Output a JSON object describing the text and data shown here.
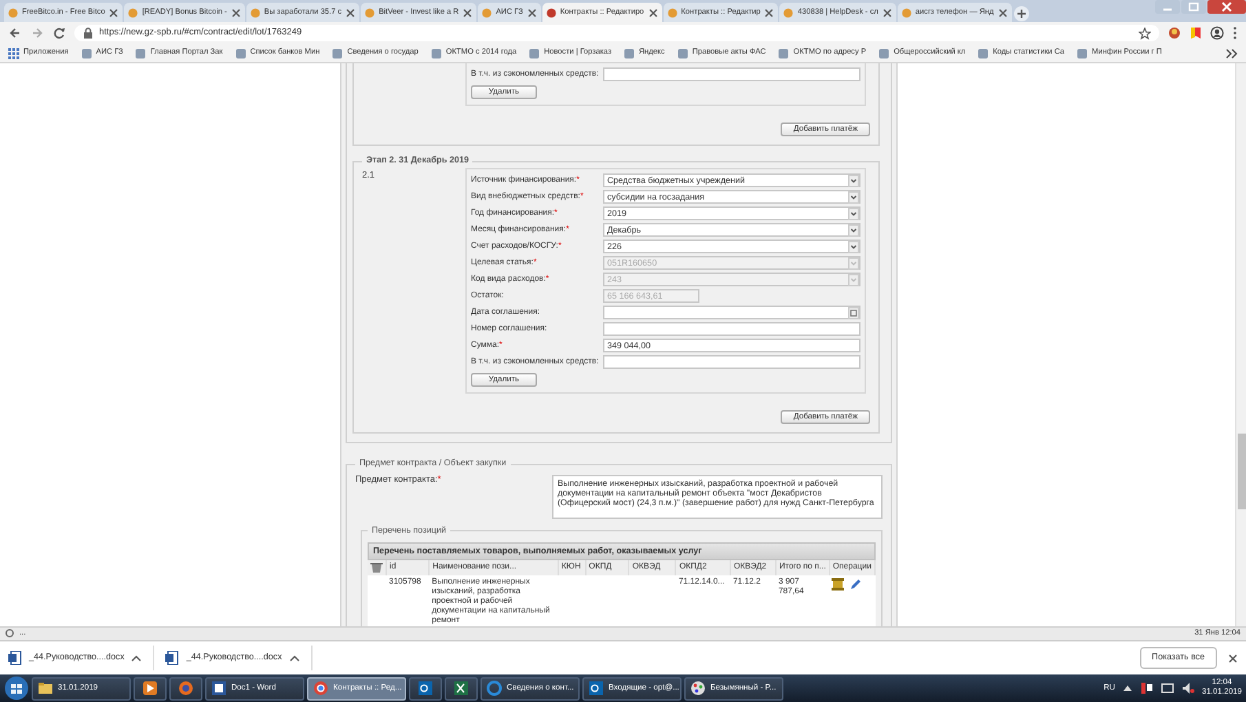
{
  "browser": {
    "tabs": [
      {
        "title": "FreeBitco.in - Free Bitco",
        "selected": false
      },
      {
        "title": "[READY] Bonus Bitcoin -",
        "selected": false
      },
      {
        "title": "Вы заработали 35.7 с",
        "selected": false
      },
      {
        "title": "BitVeer - Invest like a R",
        "selected": false
      },
      {
        "title": "АИС ГЗ",
        "selected": false
      },
      {
        "title": "Контракты :: Редактиро",
        "selected": true
      },
      {
        "title": "Контракты :: Редактир",
        "selected": false
      },
      {
        "title": "430838 | HelpDesk - сл",
        "selected": false
      },
      {
        "title": "аисгз телефон — Янд",
        "selected": false
      }
    ],
    "url": "https://new.gz-spb.ru/#cm/contract/edit/lot/1763249",
    "bookmarks": [
      "Приложения",
      "АИС ГЗ",
      "Главная Портал Зак",
      "Список банков Мин",
      "Сведения о государ",
      "ОКТМО с 2014 года",
      "Новости | Горзаказ",
      "Яндекс",
      "Правовые акты ФАС",
      "ОКТМО по адресу Р",
      "Общероссийский кл",
      "Коды статистики Са",
      "Минфин России г П"
    ]
  },
  "required_mark": "*",
  "stage1": {
    "fields": [
      {
        "label": "В т.ч. из сэкономленных средств:",
        "kind": "text",
        "required": false,
        "disabled": false
      }
    ],
    "delete_button": "Удалить",
    "add_payment_button": "Добавить платёж"
  },
  "stage2": {
    "legend": "Этап 2. 31 Декабрь 2019",
    "number": "2.1",
    "fields": [
      {
        "label": "Источник финансирования:",
        "kind": "select",
        "required": true,
        "disabled": false,
        "value": "Средства бюджетных учреждений"
      },
      {
        "label": "Вид внебюджетных средств:",
        "kind": "select",
        "required": true,
        "disabled": false,
        "value": "субсидии на госзадания"
      },
      {
        "label": "Год финансирования:",
        "kind": "select",
        "required": true,
        "disabled": false,
        "value": "2019"
      },
      {
        "label": "Месяц финансирования:",
        "kind": "select",
        "required": true,
        "disabled": false,
        "value": "Декабрь"
      },
      {
        "label": "Счет расходов/КОСГУ:",
        "kind": "select",
        "required": true,
        "disabled": false,
        "value": "226"
      },
      {
        "label": "Целевая статья:",
        "kind": "select",
        "required": true,
        "disabled": true,
        "value": "051R160650"
      },
      {
        "label": "Код вида расходов:",
        "kind": "select",
        "required": true,
        "disabled": true,
        "value": "243"
      },
      {
        "label": "Остаток:",
        "kind": "readonly",
        "required": false,
        "disabled": true,
        "value": "65 166 643,61"
      },
      {
        "label": "Дата соглашения:",
        "kind": "date",
        "required": false,
        "disabled": false
      },
      {
        "label": "Номер соглашения:",
        "kind": "text",
        "required": false,
        "disabled": false
      },
      {
        "label": "Сумма:",
        "kind": "text",
        "required": true,
        "disabled": false,
        "value": "349 044,00"
      },
      {
        "label": "В т.ч. из сэкономленных средств:",
        "kind": "text",
        "required": false,
        "disabled": false
      }
    ],
    "delete_button": "Удалить",
    "add_payment_button": "Добавить платёж"
  },
  "subject": {
    "legend": "Предмет контракта / Объект закупки",
    "label": "Предмет контракта:",
    "required": true,
    "value": "Выполнение инженерных изысканий, разработка проектной и рабочей документации на капитальный ремонт объекта \"мост Декабристов (Офицерский мост) (24,3 п.м.)\" (завершение работ) для нужд Санкт-Петербурга"
  },
  "positions": {
    "legend": "Перечень позиций",
    "title": "Перечень поставляемых товаров, выполняемых работ, оказываемых услуг",
    "columns": [
      {
        "kind": "icon"
      },
      {
        "kind": "text",
        "label": "id"
      },
      {
        "kind": "text",
        "label": "Наименование пози..."
      },
      {
        "kind": "text",
        "label": "КЮН"
      },
      {
        "kind": "text",
        "label": "ОКПД"
      },
      {
        "kind": "text",
        "label": "ОКВЭД"
      },
      {
        "kind": "text",
        "label": "ОКПД2"
      },
      {
        "kind": "text",
        "label": "ОКВЭД2"
      },
      {
        "kind": "text",
        "label": "Итого по п..."
      },
      {
        "kind": "actions",
        "label": "Операции"
      }
    ],
    "rows": [
      {
        "cells": [
          null,
          "3105798",
          "Выполнение инженерных изысканий, разработка проектной и рабочей документации на капитальный ремонт",
          null,
          null,
          null,
          "71.12.14.0...",
          "71.12.2",
          "3 907 787,64",
          null
        ]
      }
    ]
  },
  "status_bar": {
    "left": "...",
    "right": "31 Янв 12:04"
  },
  "downloads": {
    "items": [
      "_44.Руководство....docx",
      "_44.Руководство....docx"
    ],
    "show_all": "Показать все"
  },
  "taskbar": {
    "items": [
      {
        "kind": "window",
        "label": "31.01.2019",
        "selected": false
      },
      {
        "kind": "pinned",
        "selected": false
      },
      {
        "kind": "pinned",
        "selected": false
      },
      {
        "kind": "window",
        "label": "Doc1 - Word",
        "selected": false
      },
      {
        "kind": "window",
        "label": "Контракты :: Ред...",
        "selected": true
      },
      {
        "kind": "pinned",
        "selected": false
      },
      {
        "kind": "pinned",
        "selected": false
      },
      {
        "kind": "window",
        "label": "Сведения о конт...",
        "selected": false
      },
      {
        "kind": "window",
        "label": "Входящие - opt@...",
        "selected": false
      },
      {
        "kind": "window",
        "label": "Безымянный - P...",
        "selected": false
      }
    ],
    "language": "RU",
    "time": "12:04",
    "date": "31.01.2019"
  }
}
